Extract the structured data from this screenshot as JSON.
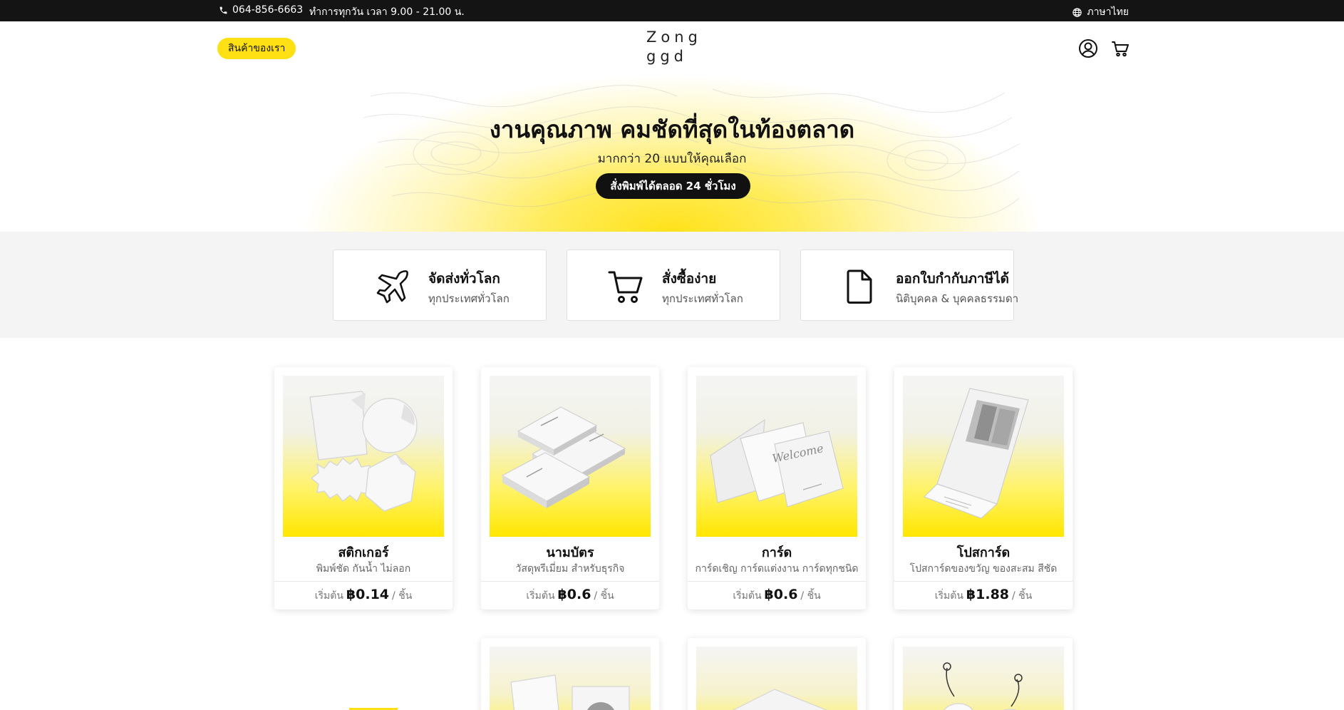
{
  "topbar": {
    "phone": "064-856-6663",
    "hours": "ทำการทุกวัน เวลา 9.00 - 21.00 น.",
    "language": "ภาษาไทย",
    "icons": [
      "phone-icon",
      "globe-icon"
    ]
  },
  "header": {
    "products_label": "สินค้าของเรา",
    "logo_line1": "Zong",
    "logo_line2": "ggd",
    "icons": [
      "account-icon",
      "cart-icon"
    ]
  },
  "hero": {
    "title": "งานคุณภาพ คมชัดที่สุดในท้องตลาด",
    "subtitle": "มากกว่า 20 แบบให้คุณเลือก",
    "cta": "สั่งพิมพ์ได้ตลอด 24 ชั่วโมง"
  },
  "features": [
    {
      "title": "จัดส่งทั่วโลก",
      "subtitle": "ทุกประเทศทั่วโลก",
      "icon": "airplane-icon"
    },
    {
      "title": "สั่งซื้อง่าย",
      "subtitle": "ทุกประเทศทั่วโลก",
      "icon": "cart-icon"
    },
    {
      "title": "ออกใบกำกับภาษีได้",
      "subtitle": "นิติบุคคล & บุคคลธรรมดา",
      "icon": "document-icon"
    }
  ],
  "products": [
    {
      "name": "สติกเกอร์",
      "desc": "พิมพ์ชัด กันน้ำ ไม่ลอก",
      "price_prefix": "เริ่มต้น",
      "price": "฿0.14",
      "unit": "/ ชิ้น"
    },
    {
      "name": "นามบัตร",
      "desc": "วัสดุพรีเมี่ยม สำหรับธุรกิจ",
      "price_prefix": "เริ่มต้น",
      "price": "฿0.6",
      "unit": "/ ชิ้น"
    },
    {
      "name": "การ์ด",
      "desc": "การ์ดเชิญ การ์ดแต่งงาน การ์ดทุกชนิด",
      "price_prefix": "เริ่มต้น",
      "price": "฿0.6",
      "unit": "/ ชิ้น"
    },
    {
      "name": "โปสการ์ด",
      "desc": "โปสการ์ดของขวัญ ของสะสม สีชัด",
      "price_prefix": "เริ่มต้น",
      "price": "฿1.88",
      "unit": "/ ชิ้น"
    }
  ],
  "colors": {
    "accent": "#ffe014",
    "topbar": "#141414",
    "feature_bg": "#f4f4f4"
  }
}
